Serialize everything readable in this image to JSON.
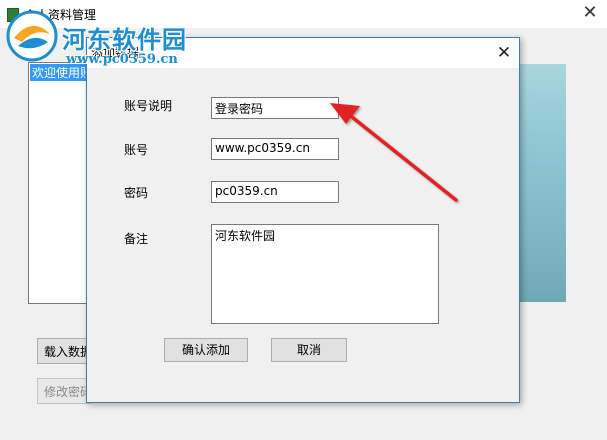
{
  "main_window": {
    "title": "个人资料管理",
    "welcome_text": "欢迎使用账",
    "load_data_button": "载入数据",
    "modify_password_button": "修改密码"
  },
  "watermark": {
    "brand": "河东软件园",
    "url": "www.pc0359.cn"
  },
  "dialog": {
    "title": "添加数据",
    "fields": {
      "account_desc": {
        "label": "账号说明",
        "value": "登录密码"
      },
      "account": {
        "label": "账号",
        "value": "www.pc0359.cn"
      },
      "password": {
        "label": "密码",
        "value": "pc0359.cn"
      },
      "notes": {
        "label": "备注",
        "value": "河东软件园"
      }
    },
    "confirm_button": "确认添加",
    "cancel_button": "取消"
  },
  "colors": {
    "dialog_border": "#3c7fb1",
    "selection": "#3399ff",
    "watermark": "#1e8ed0",
    "arrow": "#e02020"
  },
  "icons": {
    "close": "close-icon",
    "app": "app-icon",
    "logo": "watermark-logo-icon",
    "arrow": "annotation-arrow-icon"
  }
}
